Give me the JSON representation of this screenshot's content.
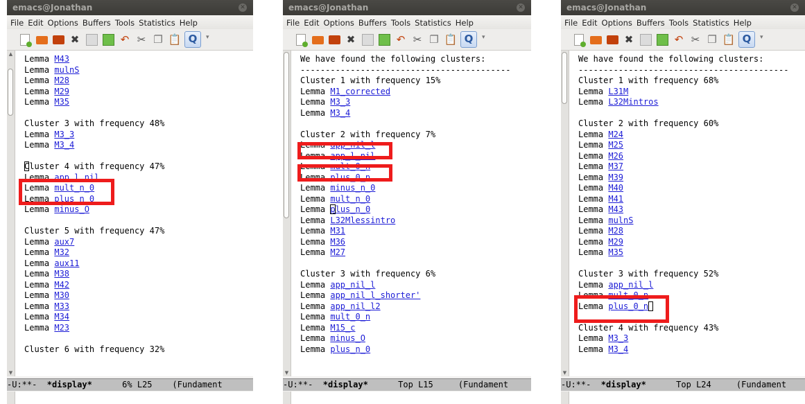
{
  "windows": [
    {
      "title": "emacs@Jonathan",
      "menu": [
        "File",
        "Edit",
        "Options",
        "Buffers",
        "Tools",
        "Statistics",
        "Help"
      ],
      "lines": [
        {
          "text": "Lemma ",
          "link": "M43"
        },
        {
          "text": "Lemma ",
          "link": "mulnS"
        },
        {
          "text": "Lemma ",
          "link": "M28"
        },
        {
          "text": "Lemma ",
          "link": "M29"
        },
        {
          "text": "Lemma ",
          "link": "M35"
        },
        {
          "text": ""
        },
        {
          "text": "Cluster 3 with frequency 48%"
        },
        {
          "text": "Lemma ",
          "link": "M3_3"
        },
        {
          "text": "Lemma ",
          "link": "M3_4"
        },
        {
          "text": ""
        },
        {
          "text": "Cluster 4 with frequency 47%",
          "cursor": 0
        },
        {
          "text": "Lemma ",
          "link": "app_l_nil"
        },
        {
          "text": "Lemma ",
          "link": "mult_n_0"
        },
        {
          "text": "Lemma ",
          "link": "plus_n_0"
        },
        {
          "text": "Lemma ",
          "link": "minus_O"
        },
        {
          "text": ""
        },
        {
          "text": "Cluster 5 with frequency 47%"
        },
        {
          "text": "Lemma ",
          "link": "aux7"
        },
        {
          "text": "Lemma ",
          "link": "M32"
        },
        {
          "text": "Lemma ",
          "link": "aux11"
        },
        {
          "text": "Lemma ",
          "link": "M38"
        },
        {
          "text": "Lemma ",
          "link": "M42"
        },
        {
          "text": "Lemma ",
          "link": "M30"
        },
        {
          "text": "Lemma ",
          "link": "M33"
        },
        {
          "text": "Lemma ",
          "link": "M34"
        },
        {
          "text": "Lemma ",
          "link": "M23"
        },
        {
          "text": ""
        },
        {
          "text": "Cluster 6 with frequency 32%"
        }
      ],
      "modeline": {
        "status": "-U:**-  ",
        "buffer": "*display*",
        "pos": "      6% L25    ",
        "mode": "(Fundament"
      }
    },
    {
      "title": "emacs@Jonathan",
      "menu": [
        "File",
        "Edit",
        "Options",
        "Buffers",
        "Tools",
        "Statistics",
        "Help"
      ],
      "lines": [
        {
          "text": "We have found the following clusters:"
        },
        {
          "text": "------------------------------------------"
        },
        {
          "text": "Cluster 1 with frequency 15%"
        },
        {
          "text": "Lemma ",
          "link": "M1_corrected"
        },
        {
          "text": "Lemma ",
          "link": "M3_3"
        },
        {
          "text": "Lemma ",
          "link": "M3_4"
        },
        {
          "text": ""
        },
        {
          "text": "Cluster 2 with frequency 7%"
        },
        {
          "text": "Lemma ",
          "link": "app_nil_l"
        },
        {
          "text": "Lemma ",
          "link": "app_l_nil"
        },
        {
          "text": "Lemma ",
          "link": "mult_0_n"
        },
        {
          "text": "Lemma ",
          "link": "plus_0_n"
        },
        {
          "text": "Lemma ",
          "link": "minus_n_0"
        },
        {
          "text": "Lemma ",
          "link": "mult_n_0"
        },
        {
          "text": "Lemma ",
          "link": "plus_n_0",
          "cursor": 6
        },
        {
          "text": "Lemma ",
          "link": "L32Mlessintro"
        },
        {
          "text": "Lemma ",
          "link": "M31"
        },
        {
          "text": "Lemma ",
          "link": "M36"
        },
        {
          "text": "Lemma ",
          "link": "M27"
        },
        {
          "text": ""
        },
        {
          "text": "Cluster 3 with frequency 6%"
        },
        {
          "text": "Lemma ",
          "link": "app_nil_l"
        },
        {
          "text": "Lemma ",
          "link": "app_nil_l_shorter'"
        },
        {
          "text": "Lemma ",
          "link": "app_nil_l2"
        },
        {
          "text": "Lemma ",
          "link": "mult_0_n"
        },
        {
          "text": "Lemma ",
          "link": "M15_c"
        },
        {
          "text": "Lemma ",
          "link": "minus_O"
        },
        {
          "text": "Lemma ",
          "link": "plus_n_0"
        }
      ],
      "modeline": {
        "status": "-U:**-  ",
        "buffer": "*display*",
        "pos": "      Top L15     ",
        "mode": "(Fundament"
      }
    },
    {
      "title": "emacs@Jonathan",
      "menu": [
        "File",
        "Edit",
        "Options",
        "Buffers",
        "Tools",
        "Statistics",
        "Help"
      ],
      "lines": [
        {
          "text": "We have found the following clusters:"
        },
        {
          "text": "------------------------------------------"
        },
        {
          "text": "Cluster 1 with frequency 68%"
        },
        {
          "text": "Lemma ",
          "link": "L31M"
        },
        {
          "text": "Lemma ",
          "link": "L32Mintros"
        },
        {
          "text": ""
        },
        {
          "text": "Cluster 2 with frequency 60%"
        },
        {
          "text": "Lemma ",
          "link": "M24"
        },
        {
          "text": "Lemma ",
          "link": "M25"
        },
        {
          "text": "Lemma ",
          "link": "M26"
        },
        {
          "text": "Lemma ",
          "link": "M37"
        },
        {
          "text": "Lemma ",
          "link": "M39"
        },
        {
          "text": "Lemma ",
          "link": "M40"
        },
        {
          "text": "Lemma ",
          "link": "M41"
        },
        {
          "text": "Lemma ",
          "link": "M43"
        },
        {
          "text": "Lemma ",
          "link": "mulnS"
        },
        {
          "text": "Lemma ",
          "link": "M28"
        },
        {
          "text": "Lemma ",
          "link": "M29"
        },
        {
          "text": "Lemma ",
          "link": "M35"
        },
        {
          "text": ""
        },
        {
          "text": "Cluster 3 with frequency 52%"
        },
        {
          "text": "Lemma ",
          "link": "app_nil_l"
        },
        {
          "text": "Lemma ",
          "link": "mult_0_n"
        },
        {
          "text": "Lemma ",
          "link": "plus_0_n",
          "cursorAfter": true
        },
        {
          "text": ""
        },
        {
          "text": "Cluster 4 with frequency 43%"
        },
        {
          "text": "Lemma ",
          "link": "M3_3"
        },
        {
          "text": "Lemma ",
          "link": "M3_4"
        }
      ],
      "modeline": {
        "status": "-U:**-  ",
        "buffer": "*display*",
        "pos": "      Top L24     ",
        "mode": "(Fundament"
      }
    }
  ],
  "icons": [
    "new-file-icon",
    "open-folder-icon",
    "dired-icon",
    "close-buffer-icon",
    "save-icon",
    "save-as-icon",
    "undo-icon",
    "cut-icon",
    "copy-icon",
    "paste-icon",
    "search-icon"
  ],
  "colors": {
    "link": "#1c1cd6",
    "highlight": "#ee1c1c",
    "modeline": "#bfbfbf",
    "titlebar": "#3c3b37"
  }
}
